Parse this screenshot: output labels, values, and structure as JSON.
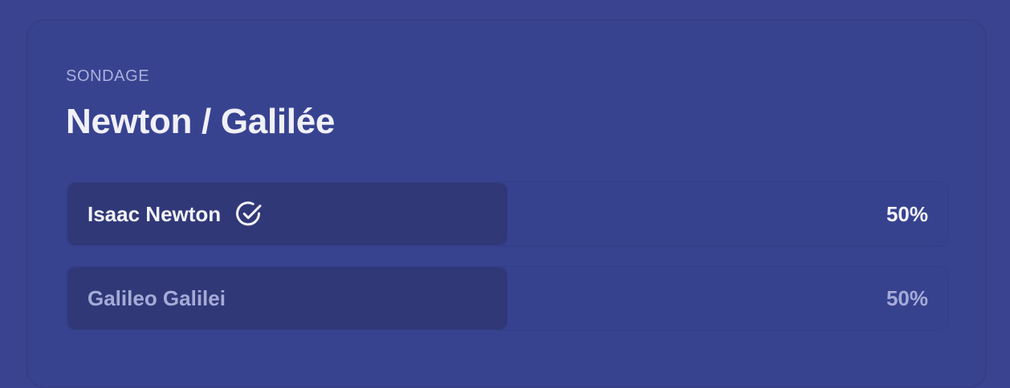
{
  "poll": {
    "eyebrow": "SONDAGE",
    "title": "Newton / Galilée",
    "options": [
      {
        "label": "Isaac Newton",
        "percent_text": "50%",
        "share": 0.5,
        "selected": true,
        "icon": "check-circle-icon"
      },
      {
        "label": "Galileo Galilei",
        "percent_text": "50%",
        "share": 0.5,
        "selected": false
      }
    ]
  },
  "colors": {
    "background": "#394390",
    "fill": "#303878",
    "text_primary": "#f2f2fa",
    "text_muted": "#a5abd6"
  }
}
